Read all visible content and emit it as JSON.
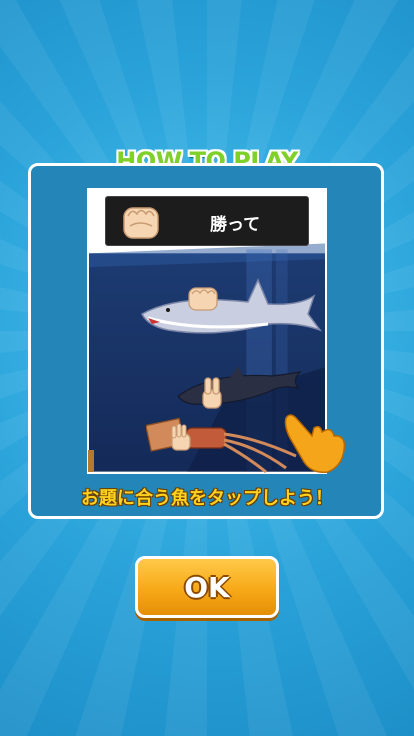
{
  "title": "HOW TO PLAY",
  "prompt": {
    "hand_icon": "rock-hand-icon",
    "text": "勝って"
  },
  "instruction": "お題に合う魚をタップしよう！",
  "ok_button": {
    "label": "OK"
  },
  "scene_items": [
    {
      "name": "shark",
      "hand": "rock-hand-icon"
    },
    {
      "name": "dolphin",
      "hand": "peace-hand-icon"
    },
    {
      "name": "squid",
      "hand": "open-hand-icon"
    }
  ],
  "colors": {
    "background": "#2aa3da",
    "card": "#2385b8",
    "title_green": "#7fd12a",
    "instruction_yellow": "#ffd21f",
    "button_orange": "#f7a917"
  }
}
